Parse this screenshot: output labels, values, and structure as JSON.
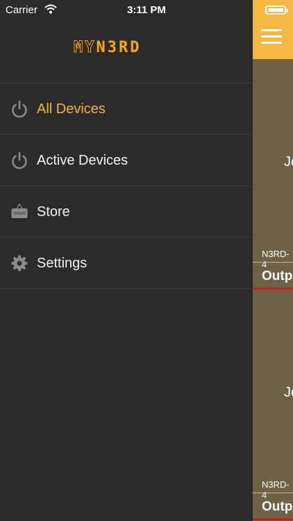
{
  "status_bar": {
    "carrier": "Carrier",
    "time": "3:11 PM"
  },
  "brand": {
    "logo_my": "MY",
    "logo_nerd": "N3RD",
    "accent_color": "#ffa800"
  },
  "menu": {
    "items": [
      {
        "label": "All Devices",
        "icon": "power-icon",
        "active": true
      },
      {
        "label": "Active Devices",
        "icon": "power-icon",
        "active": false
      },
      {
        "label": "Store",
        "icon": "sale-tag-icon",
        "active": false
      },
      {
        "label": "Settings",
        "icon": "gear-icon",
        "active": false
      }
    ]
  },
  "content": {
    "menu_button_icon": "hamburger-icon",
    "cards": [
      {
        "title_fragment": "Jo",
        "device_fragment": "N3RD-4",
        "output_fragment": "Outp"
      },
      {
        "title_fragment": "Jo",
        "device_fragment": "N3RD-4",
        "output_fragment": "Outp"
      }
    ]
  },
  "colors": {
    "menu_background": "#2b2b2b",
    "active_text": "#f3b53c",
    "top_bar": "#f5b841",
    "card_background": "#6e6146",
    "card_underline": "#c3211e"
  }
}
